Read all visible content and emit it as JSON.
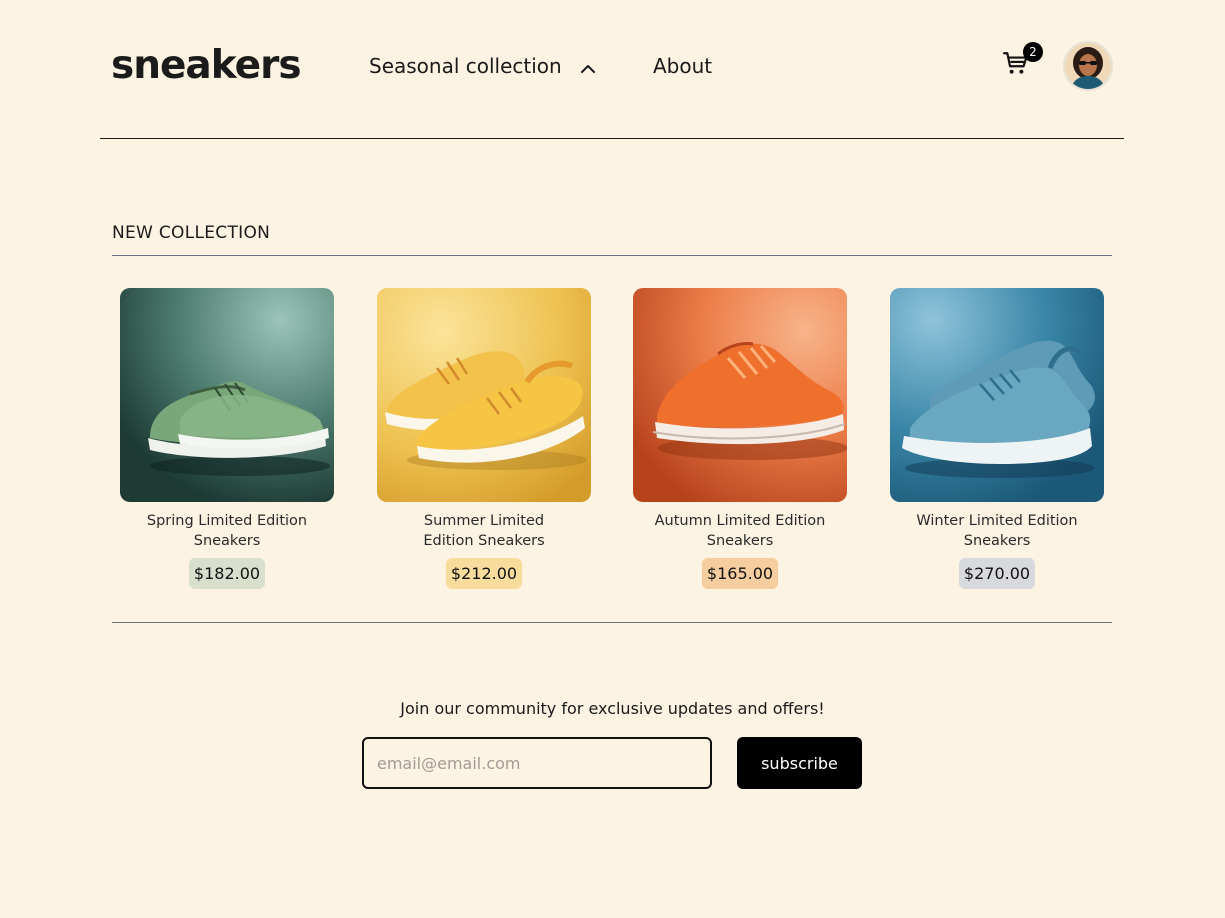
{
  "header": {
    "logo": "sneakers",
    "nav": {
      "seasonal_label": "Seasonal collection",
      "about_label": "About"
    },
    "cart": {
      "count": "2",
      "icon": "cart-icon"
    },
    "avatar": {
      "icon": "user-avatar"
    }
  },
  "main": {
    "section_title": "NEW COLLECTION",
    "products": [
      {
        "name": "Spring Limited Edition Sneakers",
        "price": "$182.00",
        "price_bg": "#d8dfcd",
        "color": "green"
      },
      {
        "name": "Summer Limited Edition Sneakers",
        "price": "$212.00",
        "price_bg": "#f7dc9c",
        "color": "yellow"
      },
      {
        "name": "Autumn Limited Edition Sneakers",
        "price": "$165.00",
        "price_bg": "#f5cd9f",
        "color": "orange"
      },
      {
        "name": "Winter Limited Edition Sneakers",
        "price": "$270.00",
        "price_bg": "#d7d9dc",
        "color": "blue"
      }
    ]
  },
  "newsletter": {
    "text": "Join our community for exclusive updates and offers!",
    "email_placeholder": "email@email.com",
    "subscribe_label": "subscribe"
  },
  "colors": {
    "background": "#fdf3e3",
    "text": "#1a1a1a",
    "button": "#000000"
  }
}
